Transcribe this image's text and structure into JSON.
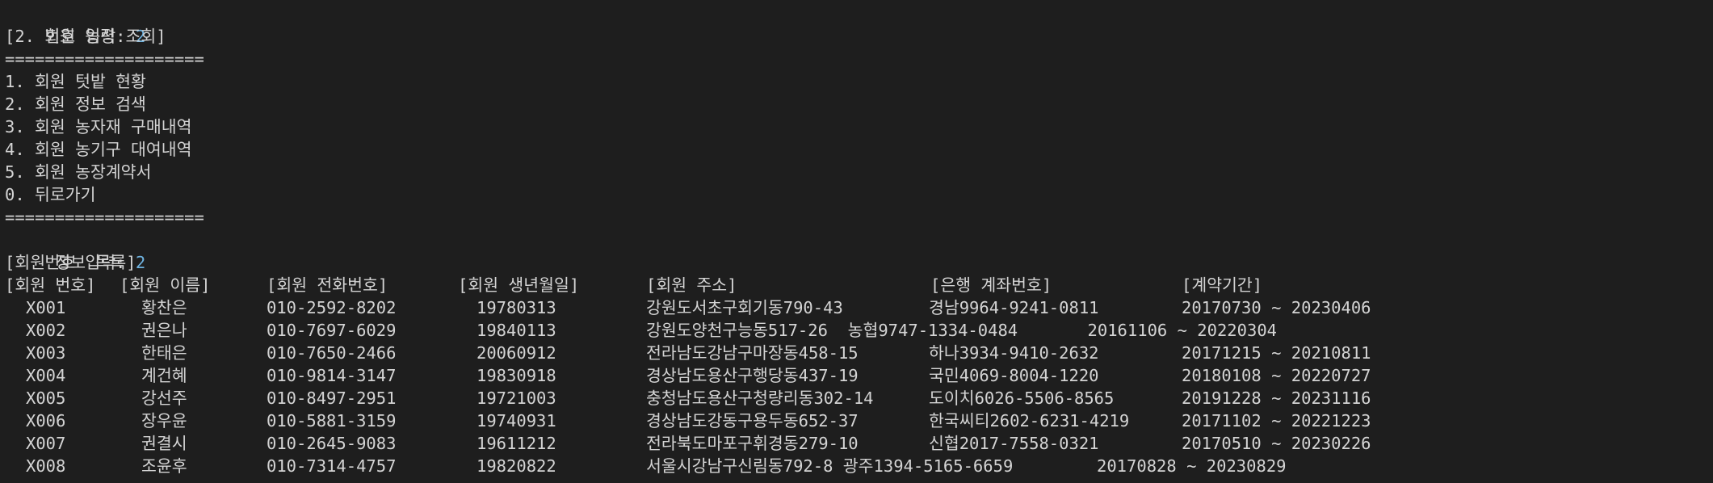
{
  "console": {
    "prompt1_label": "번호 입력: ",
    "prompt1_value": "2",
    "section_title": "[2. 회원 농장 조회]",
    "separator_top": "====================",
    "menu": [
      "1. 회원 텃밭 현황",
      "2. 회원 정보 검색",
      "3. 회원 농자재 구매내역",
      "4. 회원 농기구 대여내역",
      "5. 회원 농장계약서",
      "0. 뒤로가기"
    ],
    "separator_bottom": "====================",
    "prompt2_label": "번호 입력: ",
    "prompt2_value": "2",
    "list_title": "[회원 정보 목록]"
  },
  "table": {
    "headers": {
      "id": "[회원 번호]",
      "name": "[회원 이름]",
      "phone": "[회원 전화번호]",
      "birth": "[회원 생년월일]",
      "address": "[회원 주소]",
      "account": "[은행 계좌번호]",
      "period": "[계약기간]"
    },
    "rows": [
      {
        "id": "X001",
        "name": "황찬은",
        "phone": "010-2592-8202",
        "birth": "19780313",
        "rest": [
          {
            "text": "강원도서초구회기동790-43",
            "col": "address"
          },
          {
            "text": "경남9964-9241-0811",
            "col": "account"
          },
          {
            "text": "20170730 ~ 20230406",
            "col": "period"
          }
        ]
      },
      {
        "id": "X002",
        "name": "권은나",
        "phone": "010-7697-6029",
        "birth": "19840113",
        "rest": [
          {
            "text": "강원도양천구능동517-26  농협9747-1334-0484       20161106 ~ 20220304",
            "col": "address"
          }
        ]
      },
      {
        "id": "X003",
        "name": "한태은",
        "phone": "010-7650-2466",
        "birth": "20060912",
        "rest": [
          {
            "text": "전라남도강남구마장동458-15",
            "col": "address"
          },
          {
            "text": "하나3934-9410-2632",
            "col": "account"
          },
          {
            "text": "20171215 ~ 20210811",
            "col": "period"
          }
        ]
      },
      {
        "id": "X004",
        "name": "계건혜",
        "phone": "010-9814-3147",
        "birth": "19830918",
        "rest": [
          {
            "text": "경상남도용산구행당동437-19",
            "col": "address"
          },
          {
            "text": "국민4069-8004-1220",
            "col": "account"
          },
          {
            "text": "20180108 ~ 20220727",
            "col": "period"
          }
        ]
      },
      {
        "id": "X005",
        "name": "강선주",
        "phone": "010-8497-2951",
        "birth": "19721003",
        "rest": [
          {
            "text": "충청남도용산구청량리동302-14",
            "col": "address"
          },
          {
            "text": "도이치6026-5506-8565",
            "col": "account"
          },
          {
            "text": "20191228 ~ 20231116",
            "col": "period"
          }
        ]
      },
      {
        "id": "X006",
        "name": "장우윤",
        "phone": "010-5881-3159",
        "birth": "19740931",
        "rest": [
          {
            "text": "경상남도강동구용두동652-37",
            "col": "address"
          },
          {
            "text": "한국씨티2602-6231-4219",
            "col": "account"
          },
          {
            "text": "20171102 ~ 20221223",
            "col": "period"
          }
        ]
      },
      {
        "id": "X007",
        "name": "권결시",
        "phone": "010-2645-9083",
        "birth": "19611212",
        "rest": [
          {
            "text": "전라북도마포구휘경동279-10",
            "col": "address"
          },
          {
            "text": "신협2017-7558-0321",
            "col": "account"
          },
          {
            "text": "20170510 ~ 20230226",
            "col": "period"
          }
        ]
      },
      {
        "id": "X008",
        "name": "조윤후",
        "phone": "010-7314-4757",
        "birth": "19820822",
        "rest": [
          {
            "text": "서울시강남구신림동792-8 광주1394-5165-6659",
            "col": "address"
          },
          {
            "text": "20170828 ~ 20230829",
            "col": "period_shift"
          }
        ]
      }
    ]
  }
}
